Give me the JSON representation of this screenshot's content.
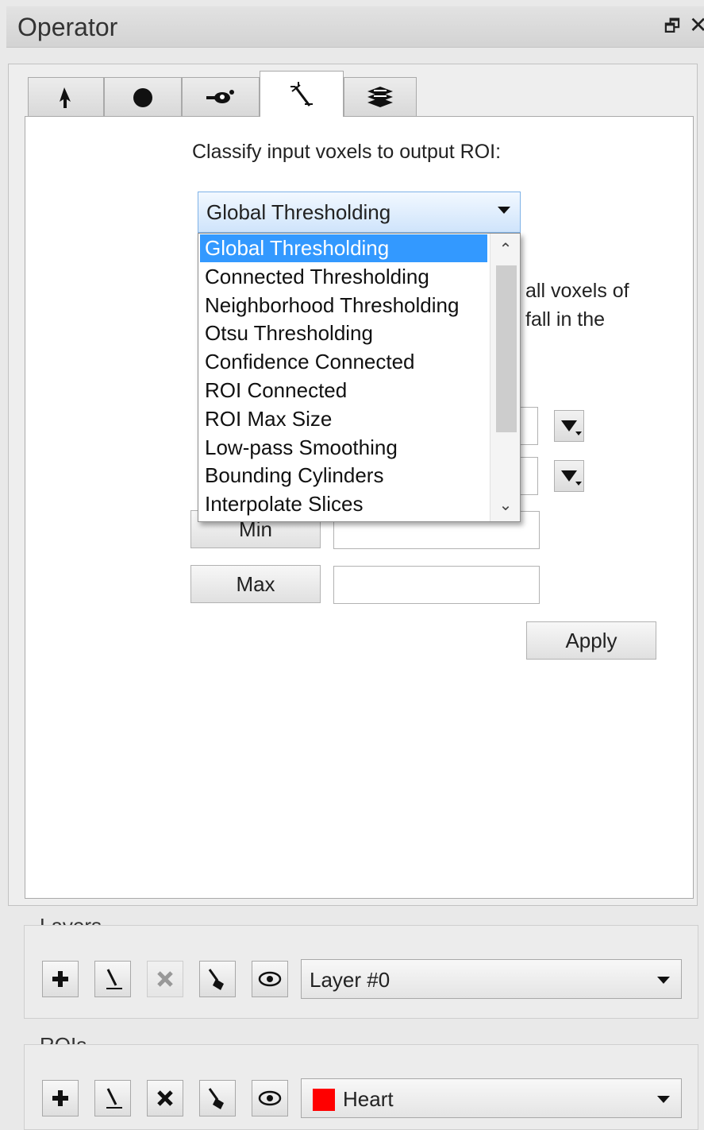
{
  "window": {
    "title": "Operator",
    "float_glyph": "🗗",
    "close_glyph": "✕"
  },
  "tabs": [
    {
      "icon": "pointer-icon",
      "active": false
    },
    {
      "icon": "circle-icon",
      "active": false
    },
    {
      "icon": "brush-icon",
      "active": false
    },
    {
      "icon": "wand-icon",
      "active": true
    },
    {
      "icon": "layers-icon",
      "active": false
    }
  ],
  "classify": {
    "prompt": "Classify input voxels to output ROI:",
    "selected": "Global Thresholding",
    "options": [
      "Global Thresholding",
      "Connected Thresholding",
      "Neighborhood Thresholding",
      "Otsu Thresholding",
      "Confidence Connected",
      "ROI Connected",
      "ROI Max Size",
      "Low-pass Smoothing",
      "Bounding Cylinders",
      "Interpolate Slices"
    ],
    "desc_line1": "all voxels of",
    "desc_line2": "fall in the"
  },
  "params": {
    "min_label": "Min",
    "min_value": "",
    "max_label": "Max",
    "max_value": "",
    "apply_label": "Apply"
  },
  "layers": {
    "title": "Layers",
    "current": "Layer #0"
  },
  "rois": {
    "title": "ROIs",
    "current": "Heart",
    "current_color": "#ff0000"
  }
}
